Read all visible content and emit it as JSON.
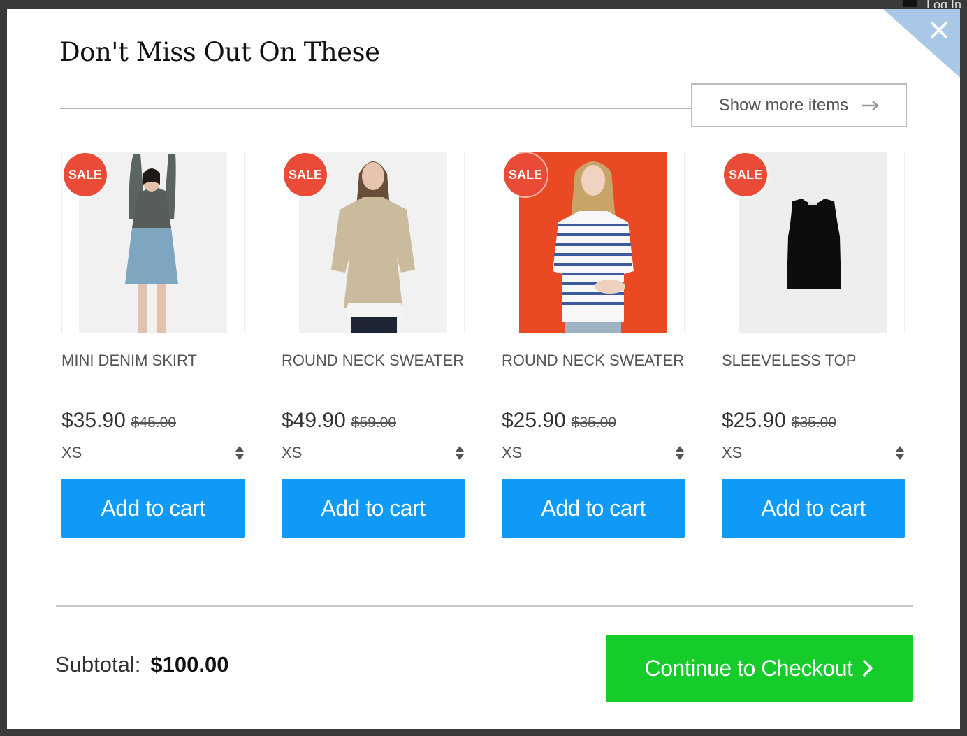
{
  "background": {
    "login_text": "Log In"
  },
  "modal": {
    "title": "Don't Miss Out On These",
    "show_more_label": "Show more items",
    "subtotal_label": "Subtotal:",
    "subtotal_value": "$100.00",
    "checkout_label": "Continue to Checkout",
    "colors": {
      "corner": "#a9c7e6",
      "add_button": "#0f9af8",
      "checkout_button": "#16cc2a",
      "sale_badge": "#ea4b37"
    }
  },
  "products": [
    {
      "name": "MINI DENIM SKIRT",
      "price": "$35.90",
      "old_price": "$45.00",
      "size": "XS",
      "badge": "SALE",
      "add_label": "Add to cart"
    },
    {
      "name": "ROUND NECK SWEATER",
      "price": "$49.90",
      "old_price": "$59.00",
      "size": "XS",
      "badge": "SALE",
      "add_label": "Add to cart"
    },
    {
      "name": "ROUND NECK SWEATER",
      "price": "$25.90",
      "old_price": "$35.00",
      "size": "XS",
      "badge": "SALE",
      "add_label": "Add to cart"
    },
    {
      "name": "SLEEVELESS TOP",
      "price": "$25.90",
      "old_price": "$35.00",
      "size": "XS",
      "badge": "SALE",
      "add_label": "Add to cart"
    }
  ]
}
